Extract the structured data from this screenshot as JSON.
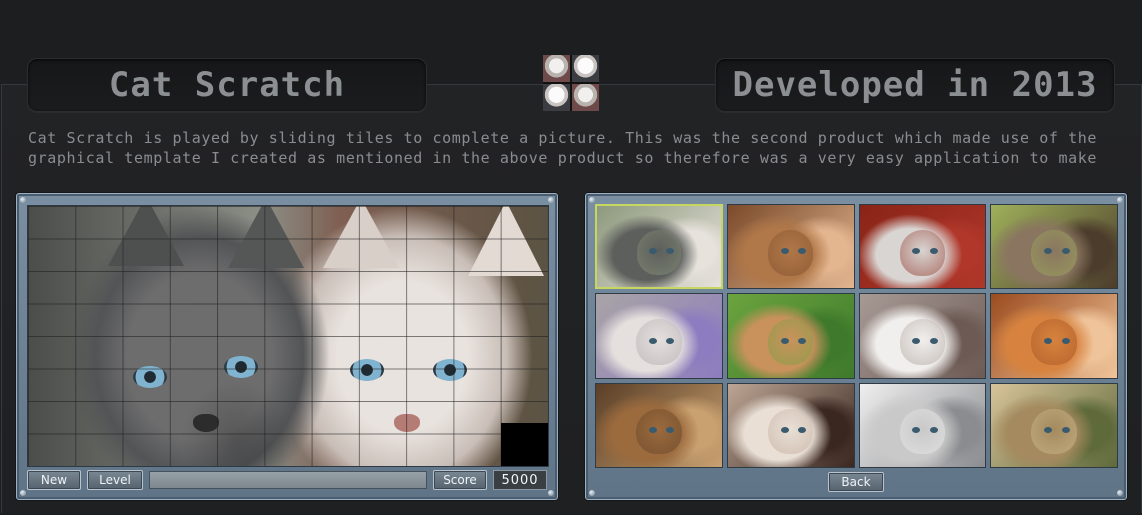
{
  "header": {
    "title": "Cat Scratch",
    "developed": "Developed in 2013"
  },
  "description": "Cat Scratch is played by sliding tiles to complete a picture. This was the second product which made use of the\ngraphical template I created as mentioned in the above product so therefore was a very easy application to make",
  "game": {
    "new_label": "New",
    "level_label": "Level",
    "score_label": "Score",
    "score_value": "5000",
    "grid_columns": 11,
    "grid_rows": 8
  },
  "gallery": {
    "back_label": "Back",
    "thumbnails": [
      {
        "name": "grey-and-white-kittens",
        "selected": true,
        "colors": [
          "#5d5f5c",
          "#e7e2dc",
          "#8d9a7d"
        ]
      },
      {
        "name": "kittens-in-basket",
        "selected": false,
        "colors": [
          "#b07748",
          "#e4b690",
          "#7a4a2a"
        ]
      },
      {
        "name": "siamese-kitten-on-red",
        "selected": false,
        "colors": [
          "#d9d5d2",
          "#b0372a",
          "#8a2418"
        ]
      },
      {
        "name": "tabby-face-green-eyes",
        "selected": false,
        "colors": [
          "#8a7660",
          "#4c3c2c",
          "#9fb15b"
        ]
      },
      {
        "name": "kittens-in-purple-basket",
        "selected": false,
        "colors": [
          "#e5e0de",
          "#8d7cbf",
          "#a9a4a6"
        ]
      },
      {
        "name": "ginger-kitten-in-grass",
        "selected": false,
        "colors": [
          "#c9925c",
          "#3f7a2c",
          "#6ba33e"
        ]
      },
      {
        "name": "two-white-kittens",
        "selected": false,
        "colors": [
          "#f1efed",
          "#6d5a55",
          "#a79a94"
        ]
      },
      {
        "name": "persian-orange-cat",
        "selected": false,
        "colors": [
          "#d7833f",
          "#f0c49a",
          "#9b4c1f"
        ]
      },
      {
        "name": "sleeping-tabby-kittens",
        "selected": false,
        "colors": [
          "#9b6a3d",
          "#c9a070",
          "#5a3f27"
        ]
      },
      {
        "name": "siamese-cat-lying",
        "selected": false,
        "colors": [
          "#e9dfd5",
          "#3a2720",
          "#bca594"
        ]
      },
      {
        "name": "four-grey-kittens",
        "selected": false,
        "colors": [
          "#c9c9c9",
          "#8b8c90",
          "#efefef"
        ]
      },
      {
        "name": "tabby-cat-with-flowers",
        "selected": false,
        "colors": [
          "#a48a5e",
          "#5e6a3a",
          "#d8c39a"
        ]
      }
    ]
  },
  "colors": {
    "accent_selected": "#c7d561",
    "panel": "#6f8396",
    "text": "#8c8f92"
  }
}
